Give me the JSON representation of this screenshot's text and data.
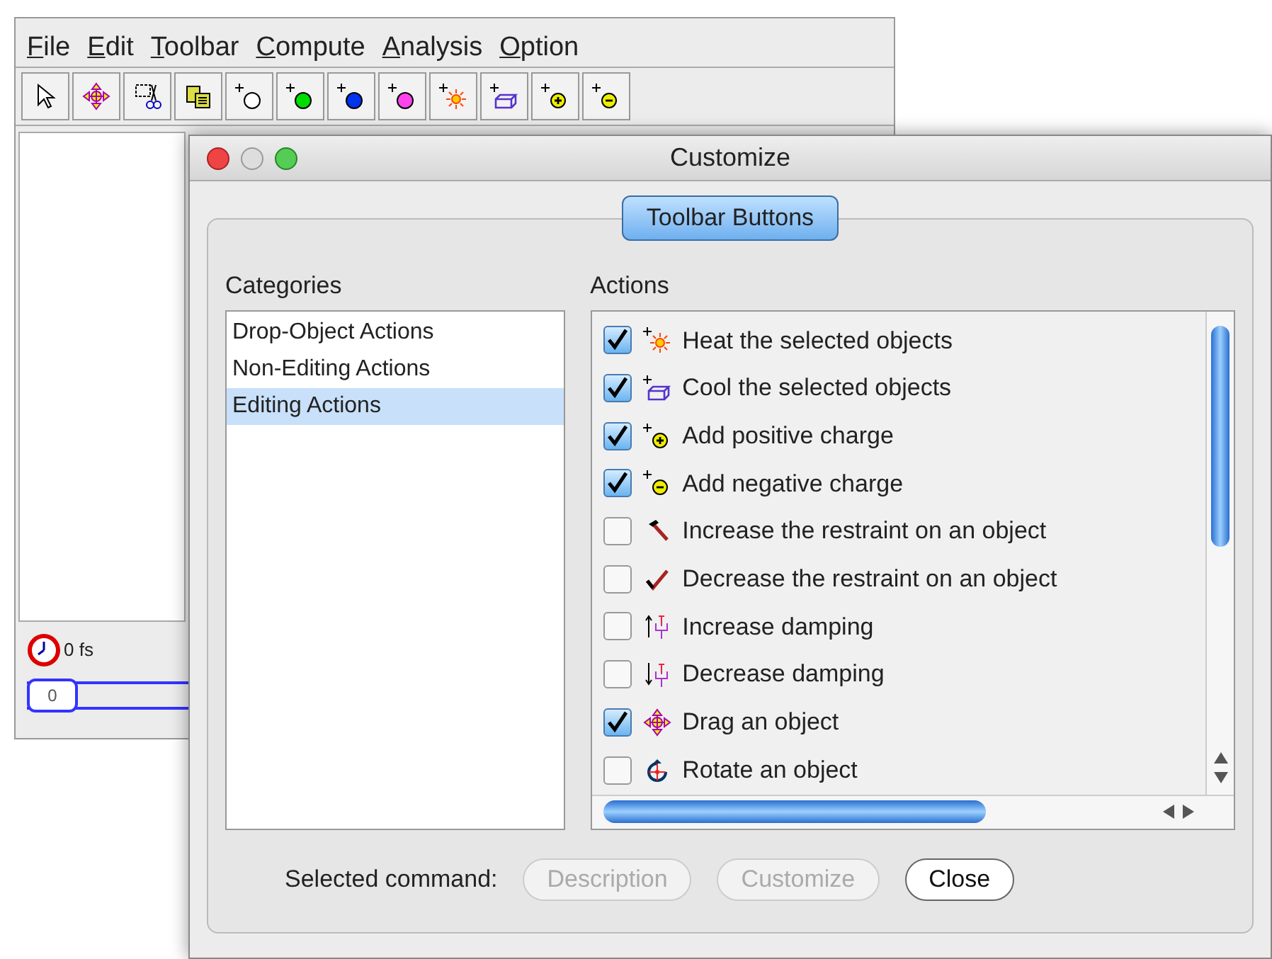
{
  "main_window": {
    "menu": [
      "File",
      "Edit",
      "Toolbar",
      "Compute",
      "Analysis",
      "Option"
    ],
    "time_display": "0 fs",
    "slider": {
      "label": "0",
      "level": 0
    }
  },
  "dialog": {
    "title": "Customize",
    "tabs": [
      {
        "label": "Toolbar Buttons",
        "selected": true
      }
    ],
    "categories_label": "Categories",
    "categories": [
      {
        "label": "Drop-Object Actions",
        "selected": false
      },
      {
        "label": "Non-Editing Actions",
        "selected": false
      },
      {
        "label": "Editing Actions",
        "selected": true
      }
    ],
    "actions_label": "Actions",
    "actions": [
      {
        "label": "Heat the selected objects",
        "checked": true
      },
      {
        "label": "Cool the selected objects",
        "checked": true
      },
      {
        "label": "Add positive charge",
        "checked": true
      },
      {
        "label": "Add negative charge",
        "checked": true
      },
      {
        "label": "Increase the restraint on an object",
        "checked": false
      },
      {
        "label": "Decrease the restraint on an object",
        "checked": false
      },
      {
        "label": "Increase damping",
        "checked": false
      },
      {
        "label": "Decrease damping",
        "checked": false
      },
      {
        "label": "Drag an object",
        "checked": true
      },
      {
        "label": "Rotate an object",
        "checked": false
      }
    ],
    "selected_command_label": "Selected command:",
    "buttons": [
      {
        "label": "Description",
        "disabled": true
      },
      {
        "label": "Customize",
        "disabled": true
      },
      {
        "label": "Close",
        "disabled": false
      }
    ]
  }
}
